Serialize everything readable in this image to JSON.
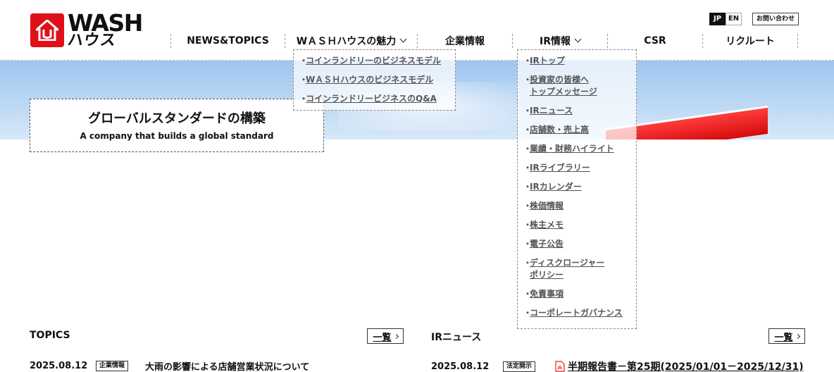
{
  "logo": {
    "line1": "WASH",
    "line2": "ハウス"
  },
  "lang": {
    "jp": "JP",
    "en": "EN"
  },
  "contact_label": "お問い合わせ",
  "nav": [
    {
      "label": "NEWS&TOPICS"
    },
    {
      "label": "WＡＳＨハウスの魅力"
    },
    {
      "label": "企業情報"
    },
    {
      "label": "IR情報"
    },
    {
      "label": "CSR"
    },
    {
      "label": "リクルート"
    }
  ],
  "hero": {
    "title_jp": "グローバルスタンダードの構築",
    "title_en": "A company that builds a global standard"
  },
  "dropdown_wash": [
    "コインランドリーのビジネスモデル",
    "WＡＳＨハウスのビジネスモデル",
    "コインランドリービジネスのQ&A"
  ],
  "dropdown_ir": [
    [
      "IRトップ"
    ],
    [
      "投資家の皆様へ",
      "トップメッセージ"
    ],
    [
      "IRニュース"
    ],
    [
      "店舗数・売上高"
    ],
    [
      "業績・財務ハイライト"
    ],
    [
      "IRライブラリー"
    ],
    [
      "IRカレンダー"
    ],
    [
      "株価情報"
    ],
    [
      "株主メモ"
    ],
    [
      "電子公告"
    ],
    [
      "ディスクロージャー",
      "ポリシー"
    ],
    [
      "免責事項"
    ],
    [
      "コーポレートガバナンス"
    ]
  ],
  "topics": {
    "title": "TOPICS",
    "more": "一覧",
    "item": {
      "date": "2025.08.12",
      "badge": "企業情報",
      "title": "大雨の影響による店舗営業状況について"
    }
  },
  "irnews": {
    "title": "IRニュース",
    "more": "一覧",
    "item": {
      "date": "2025.08.12",
      "badge": "法定開示",
      "title": "半期報告書－第25期(2025/01/01－2025/12/31)"
    }
  },
  "colors": {
    "brand_red": "#e0101a",
    "sky": "#bcd8f4"
  }
}
